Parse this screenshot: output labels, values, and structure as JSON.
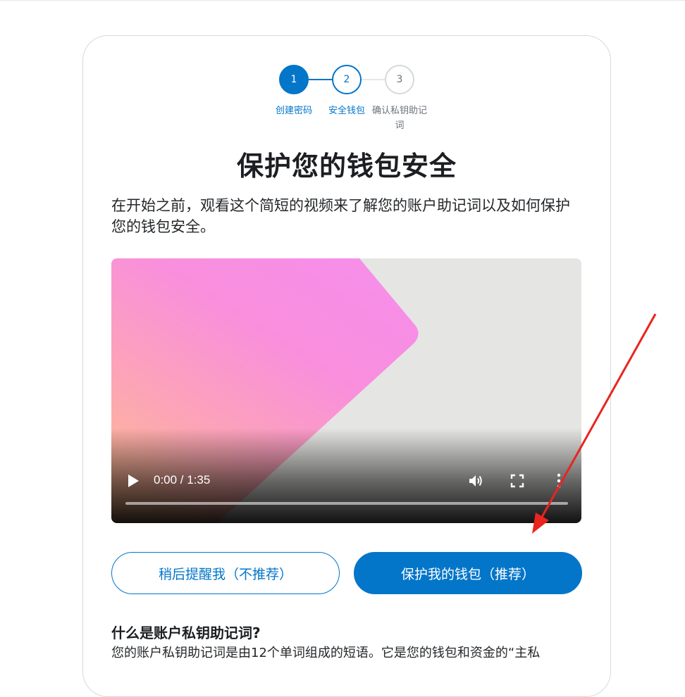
{
  "stepper": {
    "steps": [
      {
        "number": "1",
        "label": "创建密码",
        "state": "completed"
      },
      {
        "number": "2",
        "label": "安全钱包",
        "state": "active"
      },
      {
        "number": "3",
        "label": "确认私钥助记词",
        "state": "upcoming"
      }
    ]
  },
  "title": "保护您的钱包安全",
  "intro": "在开始之前，观看这个简短的视频来了解您的账户助记词以及如何保护您的钱包安全。",
  "video": {
    "time": "0:00 / 1:35",
    "progress": 0
  },
  "buttons": {
    "remind_later": "稍后提醒我（不推荐）",
    "secure_wallet": "保护我的钱包（推荐）"
  },
  "faq": {
    "title": "什么是账户私钥助记词?",
    "body": "您的账户私钥助记词是由12个单词组成的短语。它是您的钱包和资金的“主私"
  },
  "colors": {
    "accent": "#0376c9",
    "annotation_arrow": "#e8251f"
  }
}
